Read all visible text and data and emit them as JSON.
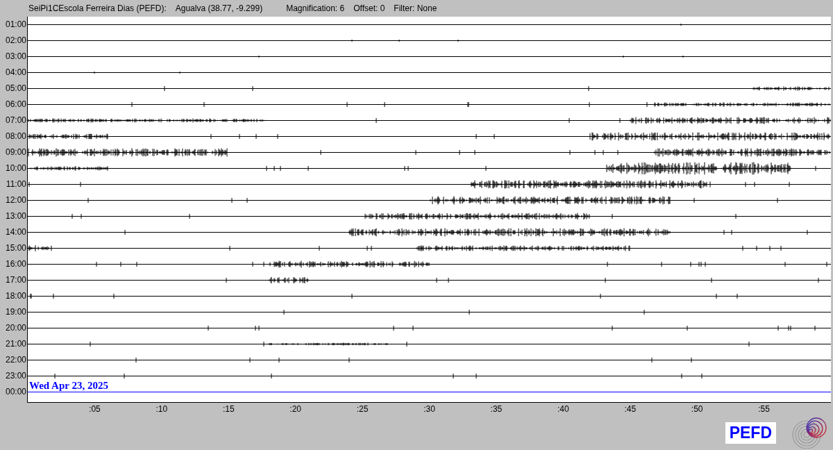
{
  "header": {
    "station": "SeiPi1CEscola Ferreira Dias (PEFD):",
    "location": "Agualva (38.77, -9.299)",
    "magnification": "Magnification: 6",
    "offset": "Offset: 0",
    "filter": "Filter: None"
  },
  "rows": [
    "01:00",
    "02:00",
    "03:00",
    "04:00",
    "05:00",
    "06:00",
    "07:00",
    "08:00",
    "09:00",
    "10:00",
    "11:00",
    "12:00",
    "13:00",
    "14:00",
    "15:00",
    "16:00",
    "17:00",
    "18:00",
    "19:00",
    "20:00",
    "21:00",
    "22:00",
    "23:00",
    "00:00"
  ],
  "date": "Wed Apr 23, 2025",
  "x_ticks": [
    ":05",
    ":10",
    ":15",
    ":20",
    ":25",
    ":30",
    ":35",
    ":40",
    ":45",
    ":50",
    ":55"
  ],
  "logo": {
    "text": "PEFD"
  }
}
